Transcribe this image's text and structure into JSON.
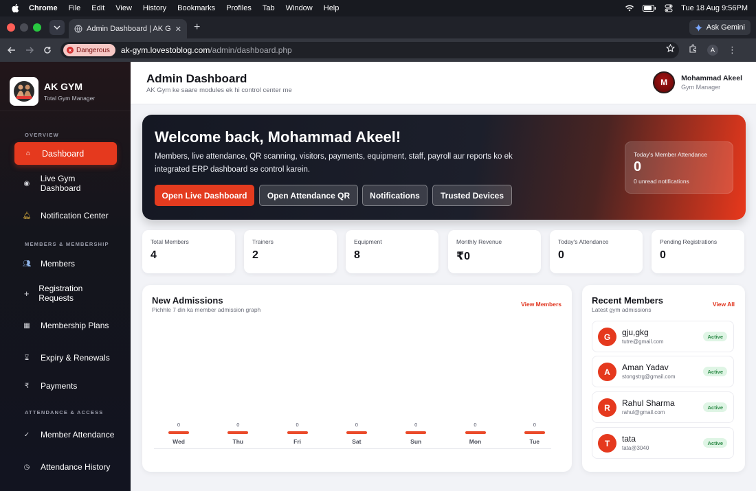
{
  "menubar": {
    "items": [
      "Chrome",
      "File",
      "Edit",
      "View",
      "History",
      "Bookmarks",
      "Profiles",
      "Tab",
      "Window",
      "Help"
    ],
    "clock": "Tue 18 Aug  9:56PM"
  },
  "browser": {
    "tab_title": "Admin Dashboard | AK Gym",
    "gemini_label": "Ask Gemini",
    "security_label": "Dangerous",
    "url_host": "ak-gym.lovestoblog.com",
    "url_path": "/admin/dashboard.php",
    "profile_initial": "A"
  },
  "sidebar": {
    "brand_name": "AK GYM",
    "brand_sub": "Total Gym Manager",
    "sections": [
      "OVERVIEW",
      "MEMBERS & MEMBERSHIP",
      "ATTENDANCE & ACCESS"
    ],
    "items": [
      {
        "label": "Dashboard",
        "icon": "home-icon"
      },
      {
        "label": "Live Gym Dashboard",
        "icon": "live-icon"
      },
      {
        "label": "Notification Center",
        "icon": "bell-icon"
      },
      {
        "label": "Members",
        "icon": "users-icon"
      },
      {
        "label": "Registration Requests",
        "icon": "plus-icon"
      },
      {
        "label": "Membership Plans",
        "icon": "plans-icon"
      },
      {
        "label": "Expiry & Renewals",
        "icon": "hourglass-icon"
      },
      {
        "label": "Payments",
        "icon": "rupee-icon"
      },
      {
        "label": "Member Attendance",
        "icon": "check-icon"
      },
      {
        "label": "Attendance History",
        "icon": "clock-icon"
      }
    ]
  },
  "header": {
    "title": "Admin Dashboard",
    "subtitle": "AK Gym ke saare modules ek hi control center me",
    "user_initial": "M",
    "user_name": "Mohammad Akeel",
    "user_role": "Gym Manager"
  },
  "hero": {
    "title": "Welcome back, Mohammad Akeel!",
    "text": "Members, live attendance, QR scanning, visitors, payments, equipment, staff, payroll aur reports ko ek integrated ERP dashboard se control karein.",
    "buttons": [
      "Open Live Dashboard",
      "Open Attendance QR",
      "Notifications",
      "Trusted Devices"
    ],
    "attendance_label": "Today's Member Attendance",
    "attendance_value": "0",
    "unread_text": "0 unread notifications"
  },
  "stats": [
    {
      "label": "Total Members",
      "value": "4"
    },
    {
      "label": "Trainers",
      "value": "2"
    },
    {
      "label": "Equipment",
      "value": "8"
    },
    {
      "label": "Monthly Revenue",
      "value": "₹0"
    },
    {
      "label": "Today's Attendance",
      "value": "0"
    },
    {
      "label": "Pending Registrations",
      "value": "0"
    }
  ],
  "admissions": {
    "title": "New Admissions",
    "subtitle": "Pichhle 7 din ka member admission graph",
    "link": "View Members"
  },
  "chart_data": {
    "type": "bar",
    "categories": [
      "Wed",
      "Thu",
      "Fri",
      "Sat",
      "Sun",
      "Mon",
      "Tue"
    ],
    "values": [
      0,
      0,
      0,
      0,
      0,
      0,
      0
    ],
    "title": "New Admissions",
    "subtitle": "Pichhle 7 din ka member admission graph",
    "xlabel": "",
    "ylabel": "",
    "grid": false
  },
  "recent": {
    "title": "Recent Members",
    "subtitle": "Latest gym admissions",
    "link": "View All",
    "members": [
      {
        "initial": "G",
        "name": "gju,gkg",
        "email": "tutre@gmail.com",
        "status": "Active"
      },
      {
        "initial": "A",
        "name": "Aman Yadav",
        "email": "stongstrg@gmail.com",
        "status": "Active"
      },
      {
        "initial": "R",
        "name": "Rahul Sharma",
        "email": "rahul@gmail.com",
        "status": "Active"
      },
      {
        "initial": "T",
        "name": "tata",
        "email": "tata@3040",
        "status": "Active"
      }
    ]
  }
}
